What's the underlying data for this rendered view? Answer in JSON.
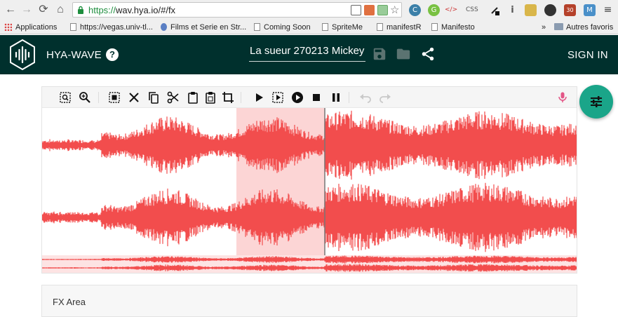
{
  "browser": {
    "url_protocol": "https://",
    "url_rest": "wav.hya.io/#/fx",
    "extensions": [
      "T",
      "A",
      "J",
      "☆",
      "C",
      "G",
      "</>",
      "CSS",
      "/",
      "i",
      "▭",
      "◉",
      "U",
      "M"
    ],
    "extension_badge": "30"
  },
  "bookmarks": [
    {
      "label": "Applications",
      "icon": "apps-grid-icon"
    },
    {
      "label": "https://vegas.univ-tl...",
      "icon": "page-icon"
    },
    {
      "label": "Films et Serie en Str...",
      "icon": "play-icon"
    },
    {
      "label": "Coming Soon",
      "icon": "page-icon"
    },
    {
      "label": "SpriteMe",
      "icon": "page-icon"
    },
    {
      "label": "manifestR",
      "icon": "page-icon"
    },
    {
      "label": "Manifesto",
      "icon": "page-icon"
    }
  ],
  "bookmarks_overflow": "»",
  "bookmarks_other": "Autres favoris",
  "app": {
    "title": "HYA-WAVE",
    "help": "?",
    "file_name": "La sueur 270213 Mickey",
    "sign_in": "SIGN IN"
  },
  "toolbar": {
    "icons": [
      "zoom-selection-icon",
      "zoom-icon",
      "select-all-icon",
      "close-icon",
      "copy-icon",
      "cut-icon",
      "paste-icon",
      "paste-special-icon",
      "crop-icon",
      "play-icon",
      "play-selection-icon",
      "record-icon",
      "stop-icon",
      "pause-icon",
      "undo-icon",
      "redo-icon",
      "microphone-icon"
    ]
  },
  "colors": {
    "header_bg": "#00302d",
    "waveform": "#f24d4d",
    "selection": "#fcd5d5",
    "fab": "#1aa589",
    "mic": "#e35586"
  },
  "fx": {
    "label": "FX Area"
  }
}
